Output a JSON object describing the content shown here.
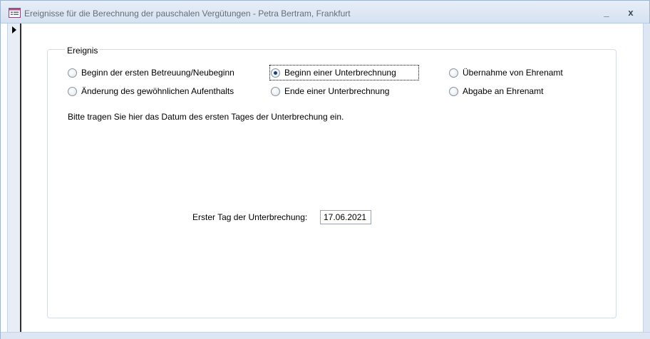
{
  "window": {
    "title": "Ereignisse für die Berechnung der pauschalen Vergütungen - Petra Bertram, Frankfurt",
    "icon": "form-icon",
    "minimize_label": "_",
    "close_label": "x"
  },
  "frame": {
    "legend": "Ereignis"
  },
  "options": [
    {
      "label": "Beginn der ersten Betreuung/Neubeginn",
      "checked": false
    },
    {
      "label": "Beginn einer Unterbrechnung",
      "checked": true
    },
    {
      "label": "Übernahme von Ehrenamt",
      "checked": false
    },
    {
      "label": "Änderung des gewöhnlichen Aufenthalts",
      "checked": false
    },
    {
      "label": "Ende einer Unterbrechnung",
      "checked": false
    },
    {
      "label": "Abgabe an Ehrenamt",
      "checked": false
    }
  ],
  "instruction": "Bitte tragen Sie hier das Datum des ersten Tages der Unterbrechung ein.",
  "date_field": {
    "label": "Erster Tag der Unterbrechung:",
    "value": "17.06.2021"
  },
  "colors": {
    "titlebar": "#dbe5f3",
    "radio_selected": "#1c3f75"
  }
}
